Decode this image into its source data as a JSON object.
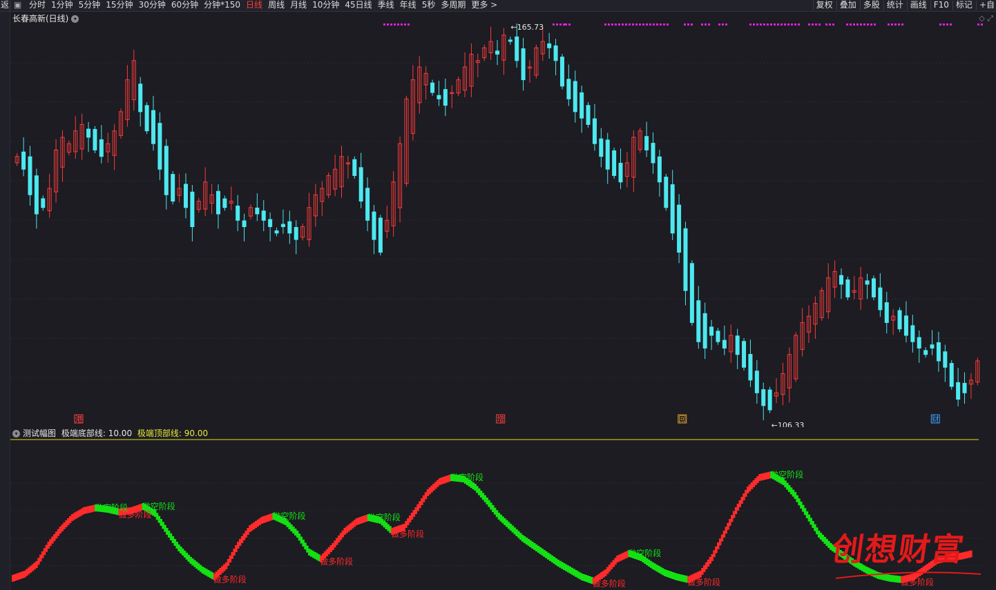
{
  "toolbar": {
    "left_glyph": "返",
    "items": [
      {
        "label": "分时",
        "active": false
      },
      {
        "label": "1分钟",
        "active": false
      },
      {
        "label": "5分钟",
        "active": false
      },
      {
        "label": "15分钟",
        "active": false
      },
      {
        "label": "30分钟",
        "active": false
      },
      {
        "label": "60分钟",
        "active": false
      },
      {
        "label": "分钟*150",
        "active": false
      },
      {
        "label": "日线",
        "active": true
      },
      {
        "label": "周线",
        "active": false
      },
      {
        "label": "月线",
        "active": false
      },
      {
        "label": "10分钟",
        "active": false
      },
      {
        "label": "45日线",
        "active": false
      },
      {
        "label": "季线",
        "active": false
      },
      {
        "label": "年线",
        "active": false
      },
      {
        "label": "5秒",
        "active": false
      },
      {
        "label": "多周期",
        "active": false
      },
      {
        "label": "更多 >",
        "active": false
      }
    ],
    "right_items": [
      "复权",
      "叠加",
      "多股",
      "统计",
      "画线",
      "F10",
      "标记",
      "+自"
    ]
  },
  "chart_title": "长春高新(日线)",
  "main_chart": {
    "high_label": "165.73",
    "low_label": "106.33",
    "event_markers": [
      {
        "label": "港",
        "color": "#ff4040",
        "index": 15
      },
      {
        "label": "增",
        "color": "#ff4040",
        "index": 119
      },
      {
        "label": "回",
        "color": "#e0a030",
        "index": 162
      },
      {
        "label": "财",
        "color": "#40a0ff",
        "index": 224
      }
    ]
  },
  "indicator": {
    "name": "测试幅图",
    "bottom_label": "极端底部线:",
    "bottom_value": "10.00",
    "top_label": "极端顶部线:",
    "top_value": "90.00",
    "short_phase": "做空阶段",
    "long_phase": "做多阶段"
  },
  "watermark": "创想财富",
  "colors": {
    "up": "#ff3b3b",
    "down": "#4de8f0",
    "magenta": "#e020e0",
    "sub_up": "#ff2a2a",
    "sub_down": "#14e014",
    "yellow_line": "#e0e020"
  },
  "chart_data": {
    "type": "candlestick",
    "price_range": [
      106.33,
      165.73
    ],
    "closes": [
      146,
      144,
      140,
      137,
      138,
      141,
      147,
      149,
      148,
      150,
      151,
      149,
      147,
      146,
      148,
      150,
      153,
      158,
      161,
      153,
      150,
      148,
      144,
      140,
      139,
      141,
      138,
      135,
      139,
      142,
      140,
      137,
      138,
      139,
      136,
      135,
      138,
      137,
      136,
      135,
      134,
      135,
      134,
      133,
      135,
      138,
      140,
      141,
      143,
      144,
      146,
      145,
      143,
      139,
      136,
      133,
      131,
      136,
      142,
      148,
      155,
      158,
      160,
      159,
      156,
      155,
      154,
      156,
      158,
      160,
      162,
      161,
      163,
      164,
      162,
      165,
      164,
      161,
      158,
      160,
      163,
      164,
      163,
      161,
      157,
      155,
      153,
      152,
      151,
      148,
      146,
      144,
      143,
      142,
      145,
      149,
      150,
      147,
      145,
      142,
      138,
      134,
      131,
      125,
      120,
      117,
      116,
      118,
      117,
      116,
      118,
      115,
      113,
      111,
      109,
      107,
      106.33,
      109,
      112,
      115,
      118,
      120,
      121,
      123,
      125,
      127,
      128,
      126,
      124,
      125,
      127,
      126,
      124,
      122,
      120,
      121,
      119,
      118,
      117,
      116,
      115,
      116,
      114,
      113,
      110,
      108,
      109,
      111,
      114
    ],
    "indicator_values": [
      6,
      9,
      16,
      30,
      41,
      50,
      55,
      57,
      56,
      54,
      55,
      58,
      53,
      40,
      28,
      19,
      12,
      7,
      15,
      30,
      42,
      48,
      51,
      47,
      38,
      25,
      20,
      29,
      40,
      47,
      50,
      48,
      40,
      43,
      55,
      68,
      76,
      79,
      78,
      72,
      62,
      51,
      43,
      35,
      29,
      23,
      17,
      12,
      7,
      4,
      10,
      20,
      24,
      21,
      15,
      10,
      7,
      5,
      9,
      21,
      38,
      55,
      70,
      79,
      81,
      76,
      66,
      52,
      38,
      29,
      23,
      17,
      12,
      8,
      6,
      5,
      7,
      13,
      19,
      21,
      22,
      24
    ],
    "indicator_ylim": [
      0,
      100
    ]
  }
}
